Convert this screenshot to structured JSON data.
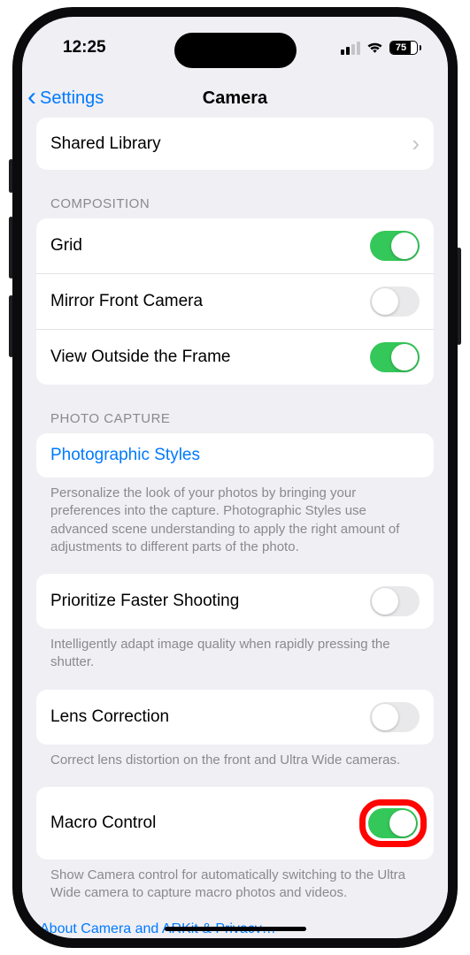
{
  "status": {
    "time": "12:25",
    "battery": "75"
  },
  "nav": {
    "back": "Settings",
    "title": "Camera"
  },
  "rows": {
    "shared_library": "Shared Library",
    "grid": "Grid",
    "mirror": "Mirror Front Camera",
    "view_outside": "View Outside the Frame",
    "photo_styles": "Photographic Styles",
    "prioritize": "Prioritize Faster Shooting",
    "lens": "Lens Correction",
    "macro": "Macro Control"
  },
  "heads": {
    "composition": "COMPOSITION",
    "capture": "PHOTO CAPTURE"
  },
  "footers": {
    "styles": "Personalize the look of your photos by bringing your preferences into the capture. Photographic Styles use advanced scene understanding to apply the right amount of adjustments to different parts of the photo.",
    "prioritize": "Intelligently adapt image quality when rapidly pressing the shutter.",
    "lens": "Correct lens distortion on the front and Ultra Wide cameras.",
    "macro": "Show Camera control for automatically switching to the Ultra Wide camera to capture macro photos and videos."
  },
  "about": "About Camera and ARKit & Privacy…",
  "toggles": {
    "grid": true,
    "mirror": false,
    "view_outside": true,
    "prioritize": false,
    "lens": false,
    "macro": true
  }
}
